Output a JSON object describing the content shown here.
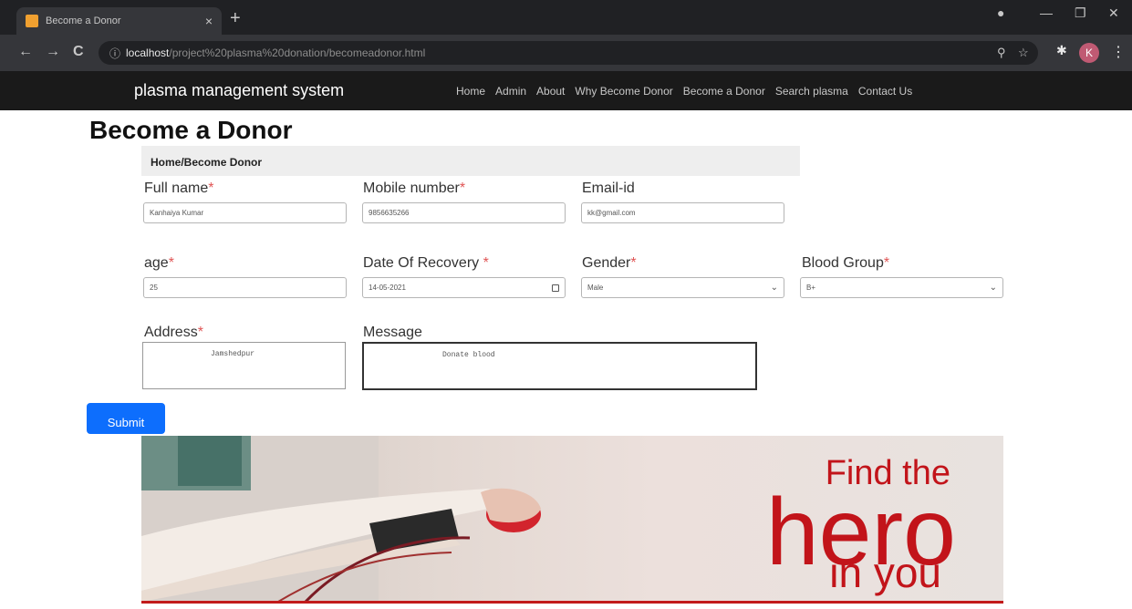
{
  "browser": {
    "tab_title": "Become a Donor",
    "tab_close": "×",
    "new_tab": "+",
    "url_host": "localhost",
    "url_path": "/project%20plasma%20donation/becomeadonor.html",
    "info_icon": "ⓘ",
    "back": "←",
    "forward": "→",
    "reload": "C",
    "search": "⚲",
    "bookmark": "☆",
    "extensions": "✱",
    "profile": "K",
    "menu": "⋮",
    "minimize": "—",
    "restore": "❐",
    "close": "✕",
    "media": "●"
  },
  "nav": {
    "brand": "plasma management system",
    "links": [
      "Home",
      "Admin",
      "About",
      "Why Become Donor",
      "Become a Donor",
      "Search plasma",
      "Contact Us"
    ]
  },
  "page": {
    "title": "Become a Donor",
    "breadcrumb": "Home/Become Donor"
  },
  "form": {
    "required_mark": "*",
    "full_name": {
      "label": "Full name",
      "value": "Kanhaiya Kumar"
    },
    "mobile": {
      "label": "Mobile number",
      "value": "9856635266"
    },
    "email": {
      "label": "Email-id",
      "value": "kk@gmail.com"
    },
    "age": {
      "label": "age",
      "value": "25"
    },
    "recovery": {
      "label": "Date Of Recovery ",
      "value": "14-05-2021"
    },
    "gender": {
      "label": "Gender",
      "value": "Male"
    },
    "blood": {
      "label": "Blood Group",
      "value": "B+"
    },
    "address": {
      "label": "Address",
      "value": "Jamshedpur"
    },
    "message": {
      "label": "Message",
      "value": "Donate blood"
    },
    "submit": "Submit"
  },
  "banner": {
    "line1": "Find the",
    "line2": "hero",
    "line3": "in you"
  },
  "colors": {
    "accent": "#0d6efd",
    "required": "#e05555",
    "banner_red": "#c2141a"
  }
}
